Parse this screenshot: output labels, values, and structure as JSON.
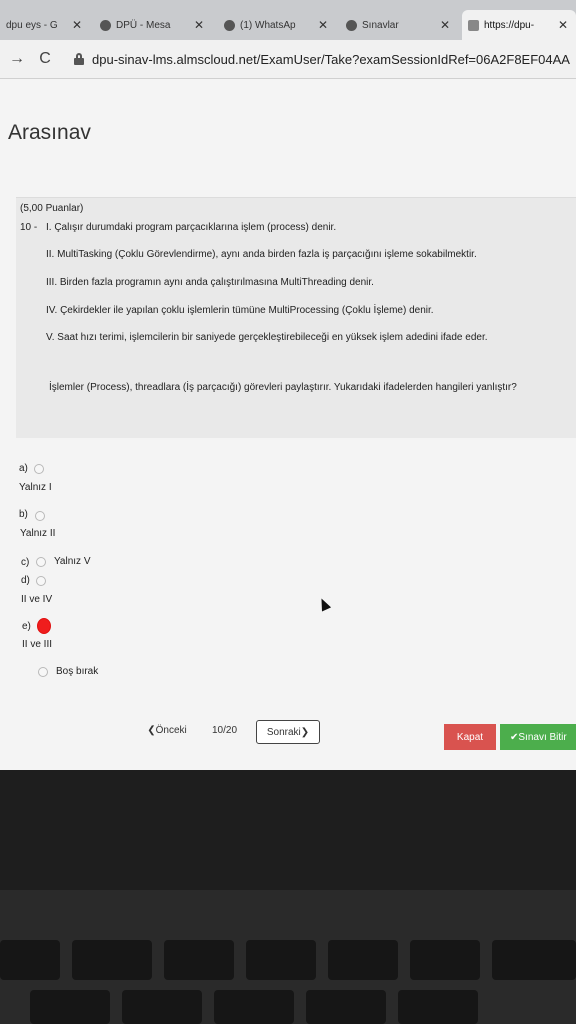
{
  "browser": {
    "tabs": [
      {
        "label": "dpu eys - G"
      },
      {
        "label": "DPÜ - Mesa"
      },
      {
        "label": "(1) WhatsAp"
      },
      {
        "label": "Sınavlar"
      },
      {
        "label": "https://dpu-"
      }
    ],
    "url": "dpu-sinav-lms.almscloud.net/ExamUser/Take?examSessionIdRef=06A2F8EF04AA"
  },
  "page": {
    "title": "Arasınav"
  },
  "question": {
    "points": "(5,00 Puanlar)",
    "number": "10 -",
    "statements": [
      "I. Çalışır durumdaki program parçacıklarına işlem (process) denir.",
      "II. MultiTasking (Çoklu Görevlendirme), aynı anda birden fazla iş parçacığını işleme sokabilmektir.",
      "III. Birden fazla programın aynı anda çalıştırılmasına MultiThreading denir.",
      "IV. Çekirdekler ile yapılan çoklu işlemlerin tümüne MultiProcessing (Çoklu İşleme) denir.",
      "V. Saat hızı terimi, işlemcilerin bir saniyede gerçekleştirebileceği en yüksek işlem adedini ifade eder."
    ],
    "prompt": "İşlemler (Process), threadlara (İş parçacığı) görevleri paylaştırır. Yukarıdaki ifadelerden hangileri yanlıştır?"
  },
  "options": [
    {
      "letter": "a)",
      "text": "Yalnız I"
    },
    {
      "letter": "b)",
      "text": "Yalnız II"
    },
    {
      "letter": "c)",
      "text": "Yalnız V"
    },
    {
      "letter": "d)",
      "text": "II ve IV"
    },
    {
      "letter": "e)",
      "text": "II ve III"
    },
    {
      "letter": "",
      "text": "Boş bırak"
    }
  ],
  "footer": {
    "prev": "❮Önceki",
    "counter": "10/20",
    "next": "Sonraki❯",
    "close": "Kapat",
    "finish": "✔Sınavı Bitir"
  },
  "colors": {
    "selected": "#ef1d1d",
    "close": "#d9534f",
    "finish": "#4cae4c"
  }
}
